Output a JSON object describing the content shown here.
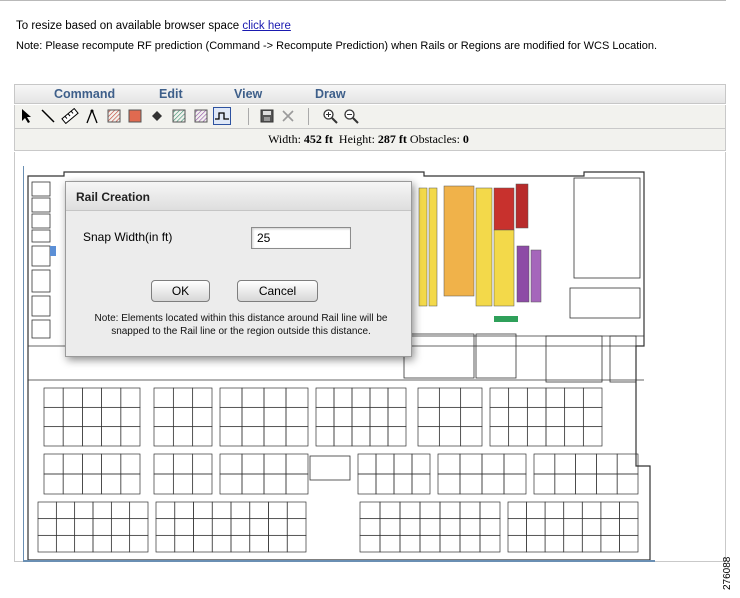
{
  "header": {
    "resize_text": "To resize based on available browser space",
    "resize_link": "click here",
    "note": "Note: Please recompute RF prediction (Command -> Recompute Prediction) when Rails or Regions are modified for WCS Location."
  },
  "menu": {
    "items": [
      {
        "label": "Command"
      },
      {
        "label": "Edit"
      },
      {
        "label": "View"
      },
      {
        "label": "Draw"
      }
    ]
  },
  "toolbar": {
    "tools": [
      "select-pointer-icon",
      "draw-line-icon",
      "ruler-icon",
      "compass-icon",
      "hatched-square-red-icon",
      "filled-square-red-icon",
      "diamond-icon",
      "hatched-square-green-icon",
      "hatched-square-purple-icon",
      "rail-tool-icon",
      "save-icon",
      "delete-x-icon",
      "zoom-in-icon",
      "zoom-out-icon"
    ],
    "selected_tool": "rail-tool-icon"
  },
  "dimensions": {
    "width_label": "Width:",
    "width_value": "452 ft",
    "height_label": "Height:",
    "height_value": "287 ft",
    "obstacles_label": "Obstacles:",
    "obstacles_value": "0"
  },
  "dialog": {
    "title": "Rail Creation",
    "snap_label": "Snap Width(in ft)",
    "snap_value": "25",
    "ok_label": "OK",
    "cancel_label": "Cancel",
    "note": "Note: Elements located within this distance around Rail line will be snapped to the Rail line or the region outside this distance."
  },
  "figure_number": "276088",
  "colors": {
    "menu_text": "#3e5f8a",
    "link": "#1a1ab0",
    "map_border": "#6a8fb3",
    "region_yellow": "#f3d94a",
    "region_orange": "#f0b24a",
    "region_red": "#c8312d",
    "region_purple": "#8d4ba6"
  }
}
